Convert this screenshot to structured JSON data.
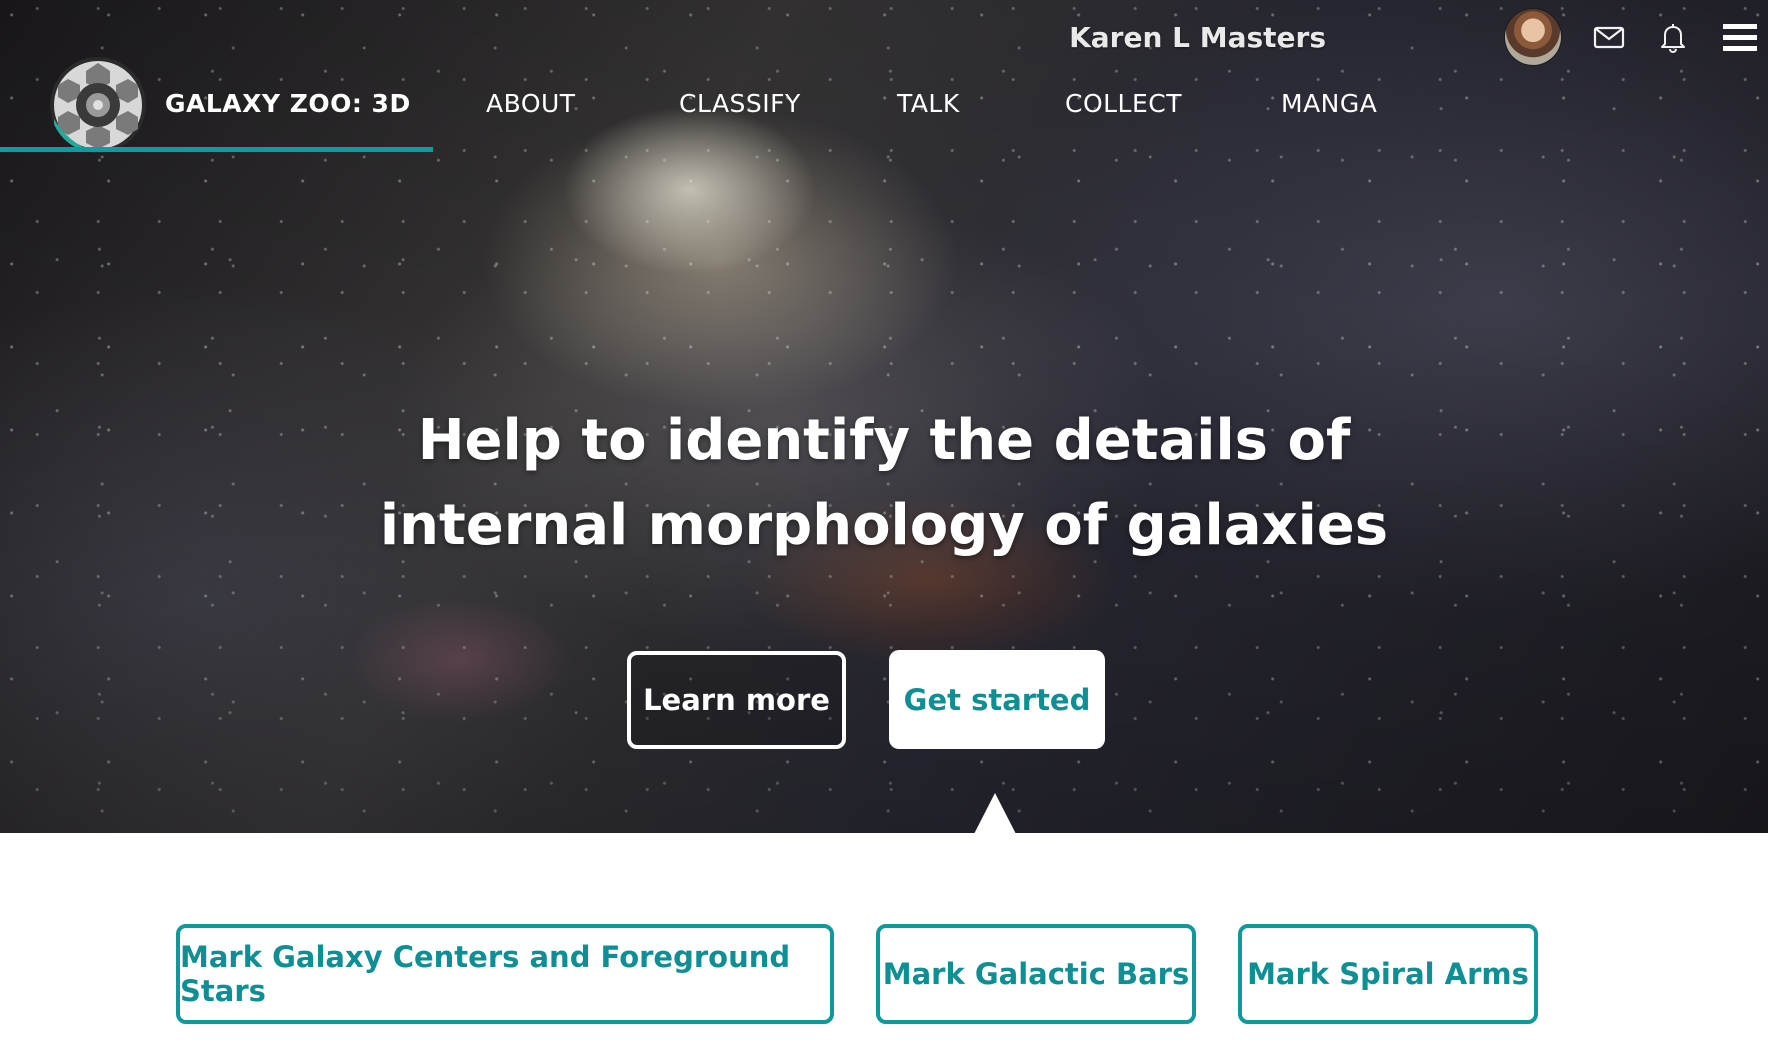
{
  "header": {
    "user_name": "Karen L Masters",
    "icons": [
      "avatar",
      "mail-icon",
      "bell-icon",
      "menu-icon"
    ]
  },
  "nav": {
    "brand": "GALAXY ZOO: 3D",
    "items": [
      {
        "label": "ABOUT"
      },
      {
        "label": "CLASSIFY"
      },
      {
        "label": "TALK"
      },
      {
        "label": "COLLECT"
      },
      {
        "label": "MANGA"
      }
    ]
  },
  "hero": {
    "headline_line1": "Help to identify the details of",
    "headline_line2": "internal morphology of galaxies",
    "learn_more": "Learn more",
    "get_started": "Get started"
  },
  "tasks": [
    {
      "label": "Mark Galaxy Centers and Foreground Stars"
    },
    {
      "label": "Mark Galactic Bars"
    },
    {
      "label": "Mark Spiral Arms"
    }
  ],
  "colors": {
    "accent": "#0f9ba0",
    "white": "#ffffff"
  }
}
